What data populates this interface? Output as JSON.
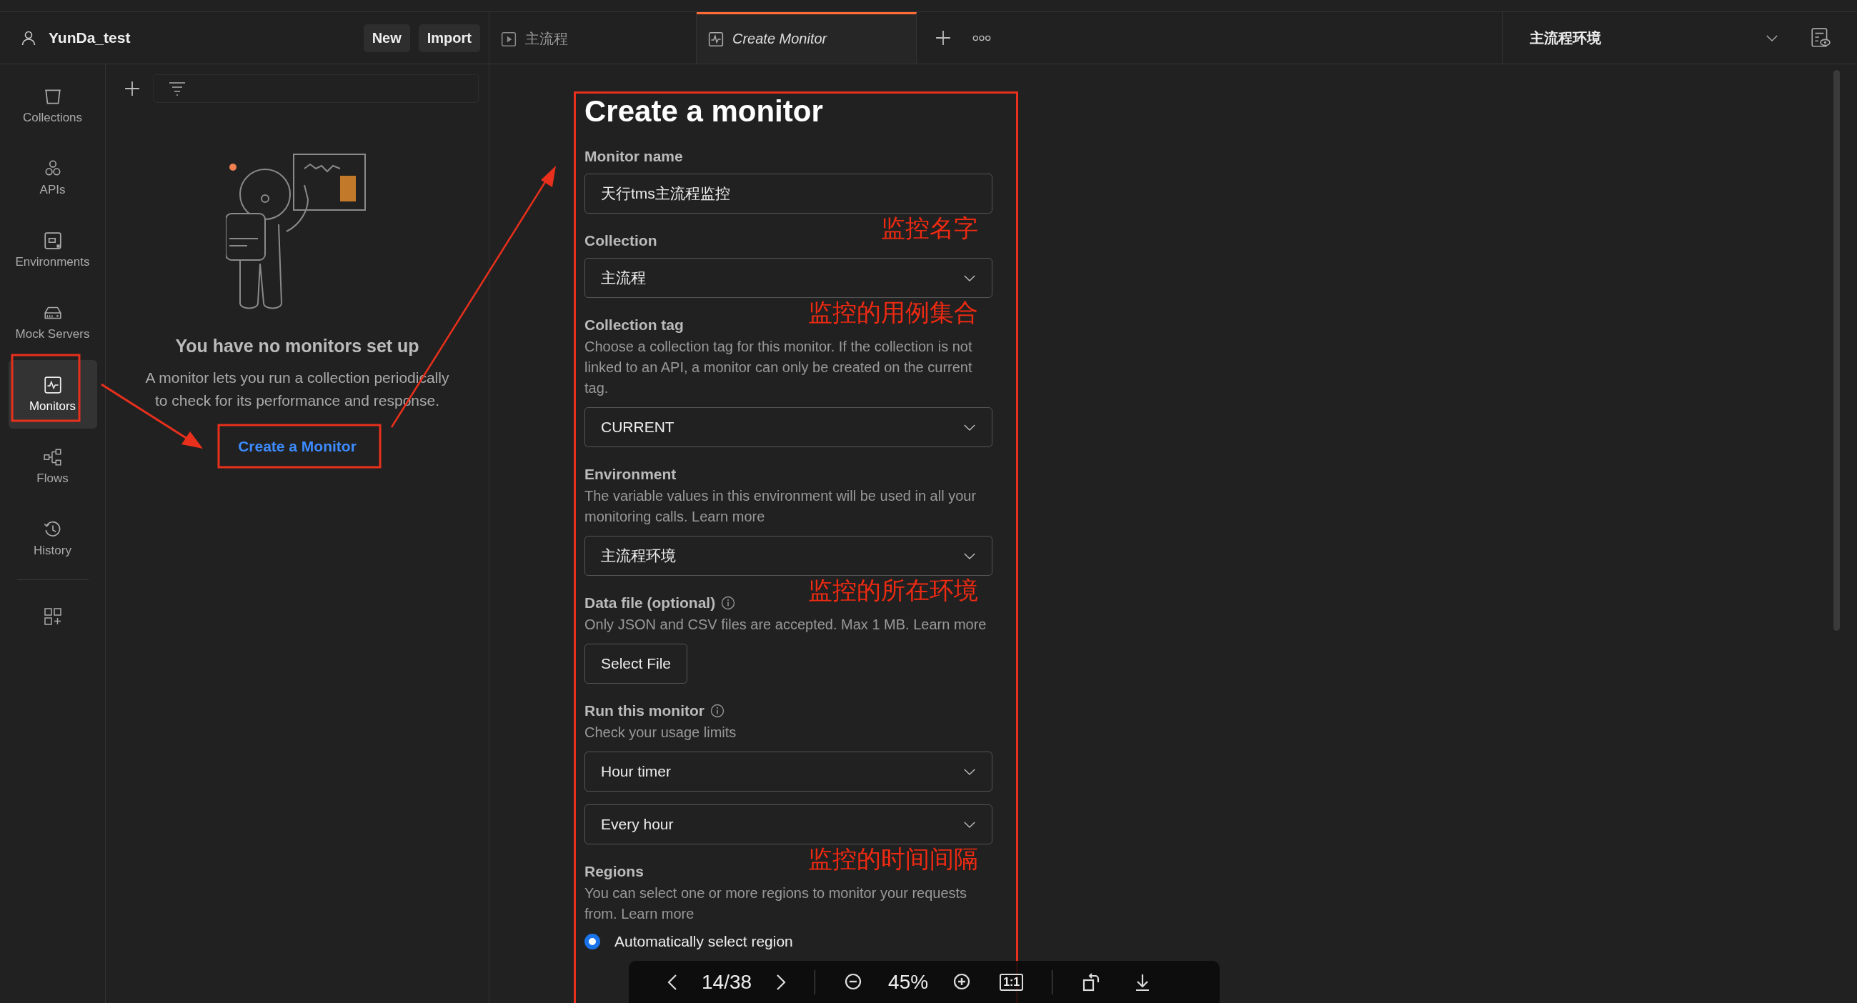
{
  "account": {
    "name": "YunDa_test"
  },
  "header_buttons": [
    "New",
    "Import"
  ],
  "tabs": [
    {
      "label": "主流程",
      "kind": "request",
      "selected": false
    },
    {
      "label": "Create Monitor",
      "kind": "monitor",
      "selected": true
    }
  ],
  "environment_selector": {
    "value": "主流程环境"
  },
  "sidebar": {
    "items": [
      {
        "label": "Collections",
        "kind": "collections",
        "selected": false
      },
      {
        "label": "APIs",
        "kind": "apis",
        "selected": false
      },
      {
        "label": "Environments",
        "kind": "environments",
        "selected": false
      },
      {
        "label": "Mock Servers",
        "kind": "mock",
        "selected": false
      },
      {
        "label": "Monitors",
        "kind": "monitors",
        "selected": true
      },
      {
        "label": "Flows",
        "kind": "flows",
        "selected": false
      },
      {
        "label": "History",
        "kind": "history",
        "selected": false
      }
    ]
  },
  "monitors_panel": {
    "empty_title": "You have no monitors set up",
    "empty_text": "A monitor lets you run a collection periodically to check for its performance and response.",
    "create_button": "Create a Monitor"
  },
  "form": {
    "title": "Create a monitor",
    "sections": [
      {
        "label": "Monitor name",
        "annotation": "监控名字",
        "controls": [
          {
            "kind": "input",
            "value": "天行tms主流程监控"
          }
        ]
      },
      {
        "label": "Collection",
        "annotation": "监控的用例集合",
        "controls": [
          {
            "kind": "select",
            "value": "主流程"
          }
        ]
      },
      {
        "label": "Collection tag",
        "description": "Choose a collection tag for this monitor. If the collection is not linked to an API, a monitor can only be created on the current tag.",
        "controls": [
          {
            "kind": "select",
            "value": "CURRENT"
          }
        ]
      },
      {
        "label": "Environment",
        "description": "The variable values in this environment will be used in all your monitoring calls.",
        "link": "Learn more",
        "annotation": "监控的所在环境",
        "controls": [
          {
            "kind": "select",
            "value": "主流程环境"
          }
        ]
      },
      {
        "label": "Data file (optional)",
        "info": true,
        "description": "Only JSON and CSV files are accepted. Max 1 MB.",
        "link": "Learn more",
        "controls": [
          {
            "kind": "button",
            "value": "Select File"
          }
        ]
      },
      {
        "label": "Run this monitor",
        "info": true,
        "description": "Check your usage limits",
        "annotation": "监控的时间间隔",
        "controls": [
          {
            "kind": "select",
            "value": "Hour timer"
          },
          {
            "kind": "select",
            "value": "Every hour"
          }
        ]
      },
      {
        "label": "Regions",
        "description": "You can select one or more regions to monitor your requests from.",
        "link": "Learn more",
        "controls": [
          {
            "kind": "radio",
            "value": "Automatically select region",
            "selected": true
          }
        ]
      }
    ]
  },
  "image_viewer": {
    "page": "14/38",
    "zoom": "45%",
    "actual_size": "1:1"
  }
}
